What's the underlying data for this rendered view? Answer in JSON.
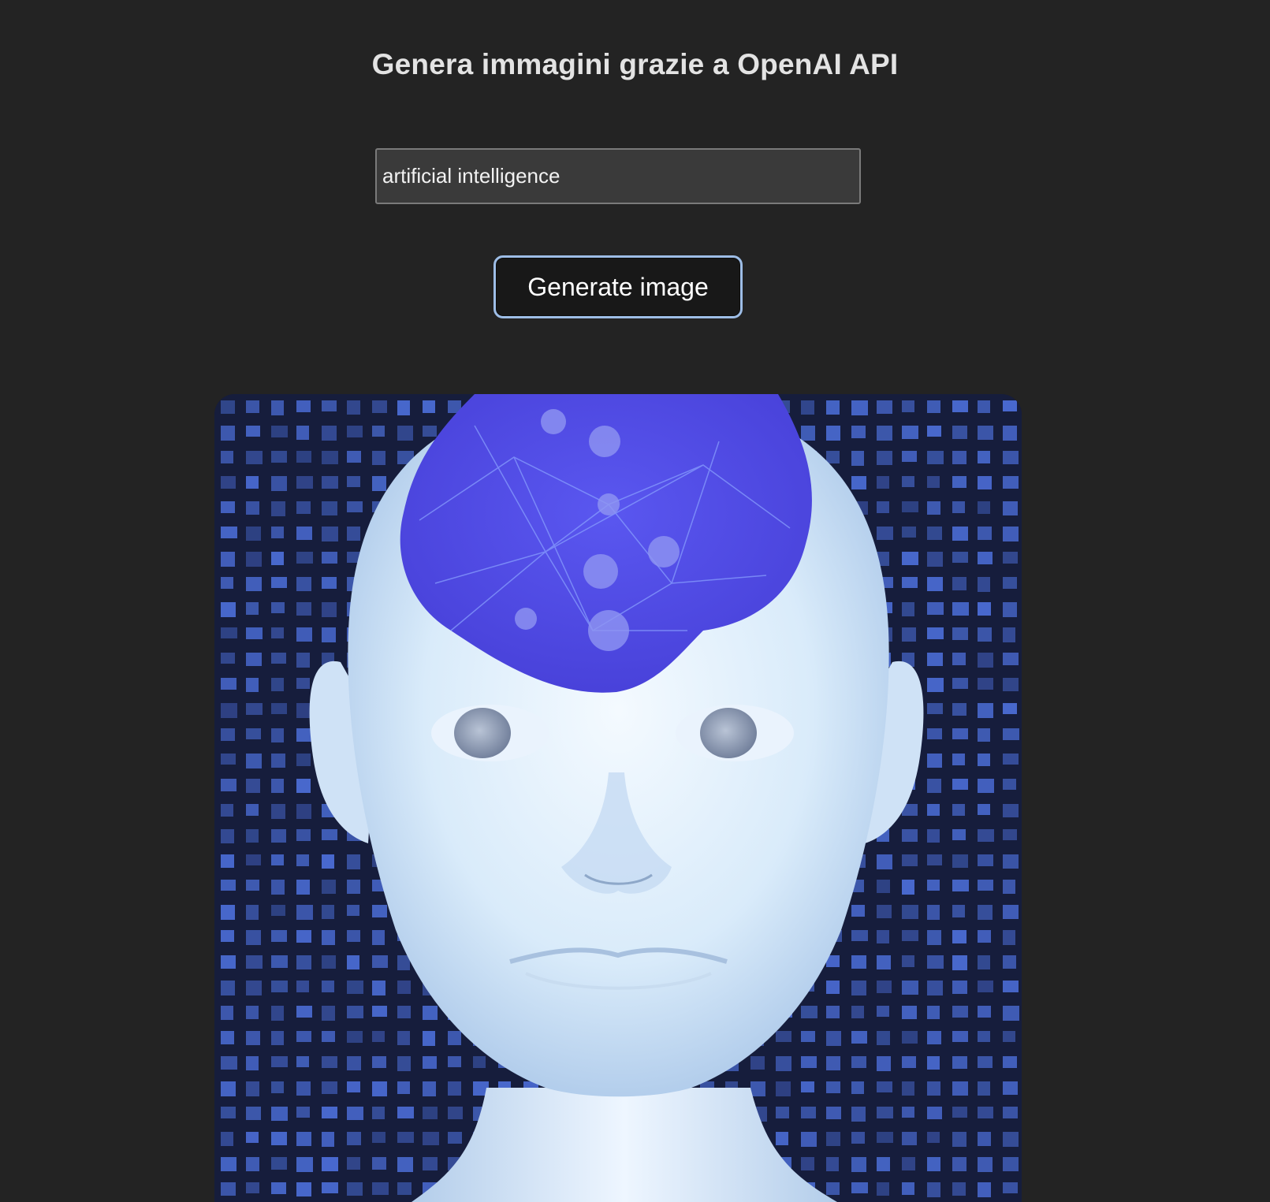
{
  "header": {
    "title": "Genera immagini grazie a OpenAI API"
  },
  "prompt": {
    "value": "artificial intelligence"
  },
  "actions": {
    "generate_label": "Generate image"
  },
  "result": {
    "depicts": "artificial intelligence",
    "colors": {
      "background": "#232323",
      "grid_dark": "#161d3c",
      "grid_tile": "#4b6dd6",
      "brain": "#4e4ae6",
      "skin": "#dfeefa"
    }
  }
}
